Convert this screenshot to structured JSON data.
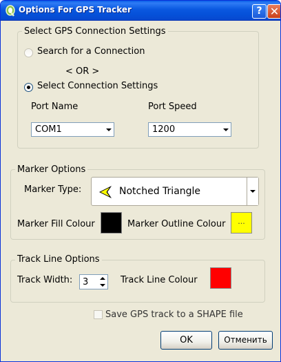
{
  "window": {
    "title": "Options For GPS Tracker",
    "help_glyph": "?",
    "close_glyph": "✕"
  },
  "gps_connection": {
    "group_title": "Select GPS Connection Settings",
    "search_label": "Search for a Connection",
    "search_checked": false,
    "or_text": "< OR >",
    "select_label": "Select Connection Settings",
    "select_checked": true,
    "port_name_label": "Port Name",
    "port_name_value": "COM1",
    "port_speed_label": "Port Speed",
    "port_speed_value": "1200"
  },
  "marker_options": {
    "group_title": "Marker Options",
    "marker_type_label": "Marker Type:",
    "marker_type_value": "Notched Triangle",
    "marker_icon": "notched-triangle-icon",
    "fill_label": "Marker Fill Colour",
    "fill_color": "#000000",
    "outline_label": "Marker Outline Colour",
    "outline_color": "#ffff00",
    "outline_button_text": "..."
  },
  "track_line_options": {
    "group_title": "Track Line Options",
    "width_label": "Track Width:",
    "width_value": "3",
    "colour_label": "Track Line Colour",
    "colour": "#ff0000"
  },
  "save_option": {
    "label": "Save GPS track to a SHAPE file",
    "checked": false
  },
  "buttons": {
    "ok": "OK",
    "cancel": "Отменить"
  },
  "colors": {
    "titlebar": "#0a58e0",
    "dialog_bg": "#ece9d8"
  }
}
